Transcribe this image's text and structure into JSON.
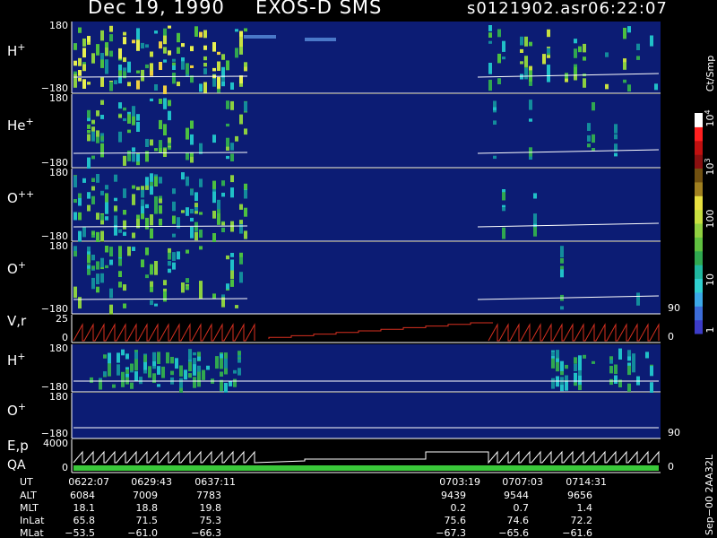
{
  "header": {
    "date": "Dec 19, 1990",
    "instrument": "EXOS-D SMS",
    "file": "s0121902.asr",
    "time": "06:22:07"
  },
  "colors": {
    "background": "#000000",
    "panel_fill": "#0c1c74",
    "trace": "#ffffff",
    "velocity_trace": "#d83020",
    "qa_bar": "#3ac83a",
    "colorbar": [
      "#3c3cc8",
      "#3c6cd8",
      "#3ca8e8",
      "#30d0d0",
      "#20b8a0",
      "#30a850",
      "#60c040",
      "#90d040",
      "#c8e040",
      "#e8e040",
      "#a08020",
      "#705010",
      "#8a1010",
      "#c01010",
      "#ff2020",
      "#ffffff"
    ]
  },
  "chart_data": {
    "type": "heatmap",
    "panels": [
      {
        "label_base": "H",
        "label_sup": "+",
        "ylim": [
          -180,
          180
        ],
        "tick_top": "180",
        "tick_bottom": "−180"
      },
      {
        "label_base": "He",
        "label_sup": "+",
        "ylim": [
          -180,
          180
        ],
        "tick_top": "180",
        "tick_bottom": "−180"
      },
      {
        "label_base": "O",
        "label_sup": "++",
        "ylim": [
          -180,
          180
        ],
        "tick_top": "180",
        "tick_bottom": "−180"
      },
      {
        "label_base": "O",
        "label_sup": "+",
        "ylim": [
          -180,
          180
        ],
        "tick_top": "180",
        "tick_bottom": "−180",
        "right_tick": "90"
      },
      {
        "label_base": "V,r",
        "label_sup": "",
        "ylim": [
          0,
          25
        ],
        "tick_top": "25",
        "tick_bottom": "0",
        "right_tick": "0"
      },
      {
        "label_base": "H",
        "label_sup": "+",
        "ylim": [
          -180,
          180
        ],
        "tick_top": "180",
        "tick_bottom": "−180"
      },
      {
        "label_base": "O",
        "label_sup": "+",
        "ylim": [
          -180,
          180
        ],
        "tick_top": "180",
        "tick_bottom": "−180",
        "right_tick": "90"
      },
      {
        "label_base": "E,p",
        "label_sup": "",
        "label2": "QA",
        "ylim": [
          0,
          4000
        ],
        "tick_top": "4000",
        "tick_bottom": "0",
        "right_tick": "0"
      }
    ],
    "colorbar": {
      "unit": "Ct/Smp",
      "ticks": [
        {
          "base": "10",
          "exp": "4"
        },
        {
          "base": "10",
          "exp": "3"
        },
        {
          "base": "100",
          "exp": ""
        },
        {
          "base": "10",
          "exp": ""
        },
        {
          "base": "1",
          "exp": ""
        }
      ]
    },
    "footer": {
      "row_labels": [
        "UT",
        "ALT",
        "MLT",
        "InLat",
        "MLat"
      ],
      "columns": [
        {
          "values": [
            "0622:07",
            "6084",
            "18.1",
            "65.8",
            "−53.5"
          ]
        },
        {
          "values": [
            "0629:43",
            "7009",
            "18.8",
            "71.5",
            "−61.0"
          ]
        },
        {
          "values": [
            "0637:11",
            "7783",
            "19.8",
            "75.3",
            "−66.3"
          ]
        },
        {
          "values": [
            "0703:19",
            "9439",
            "0.2",
            "75.6",
            "−67.3"
          ]
        },
        {
          "values": [
            "0707:03",
            "9544",
            "0.7",
            "74.6",
            "−65.6"
          ]
        },
        {
          "values": [
            "0714:31",
            "9656",
            "1.4",
            "72.2",
            "−61.6"
          ]
        }
      ]
    },
    "side_note": "Sep−00 2AA32L"
  }
}
